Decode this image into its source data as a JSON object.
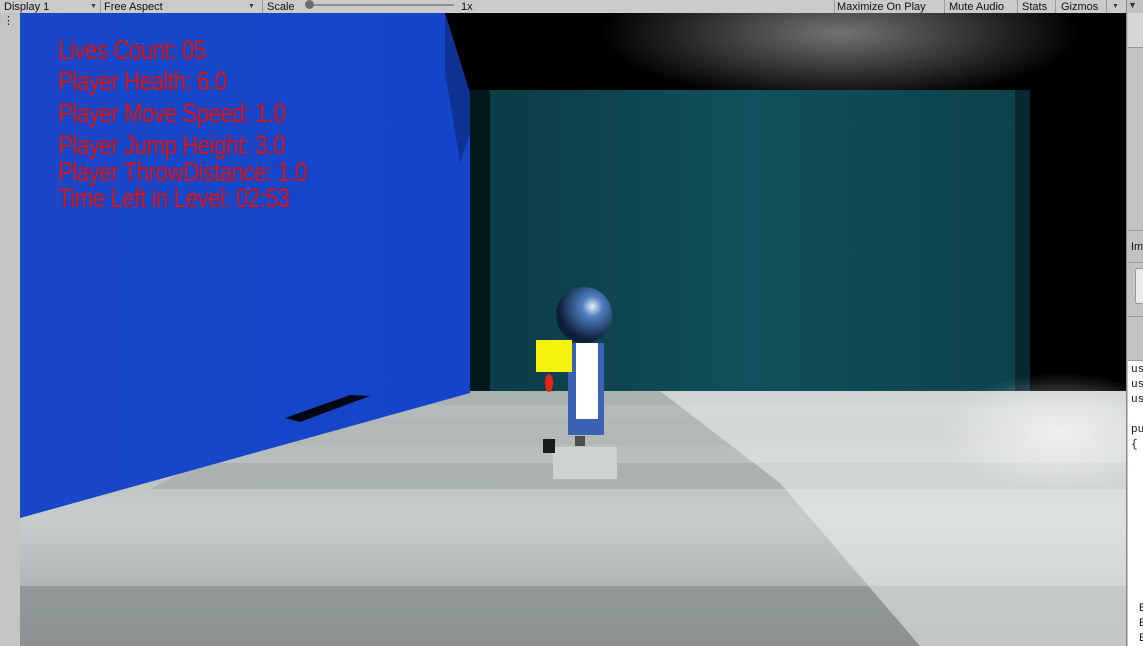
{
  "toolbar": {
    "display_label": "Display 1",
    "aspect_label": "Free Aspect",
    "scale_label": "Scale",
    "scale_value": "1x",
    "maximize_label": "Maximize On Play",
    "mute_label": "Mute Audio",
    "stats_label": "Stats",
    "gizmos_label": "Gizmos",
    "dropdown_icon": "chevron-down-icon"
  },
  "gutter": {
    "menu_icon": "kebab-menu-icon",
    "menu_glyph": "⋮"
  },
  "hud": {
    "color": "#d0181e",
    "lives": "Lives Count: 05",
    "health": "Player Health: 6.0",
    "move_speed": "Player Move Speed: 1.0",
    "jump_height": "Player Jump Height: 3.0",
    "throw_distance": "Player ThrowDistance: 1.0",
    "time_left": "Time Left in Level: 02:53"
  },
  "scene": {
    "wall_color": "#1646c8",
    "back_wall_color": "#0f4a55",
    "floor_color": "#c9d0d0"
  },
  "inspector": {
    "partial_label": "Im",
    "code_lines": [
      "us",
      "us",
      "us",
      "pu",
      "{"
    ],
    "bottom_lines": [
      "E",
      "E",
      "E"
    ]
  }
}
